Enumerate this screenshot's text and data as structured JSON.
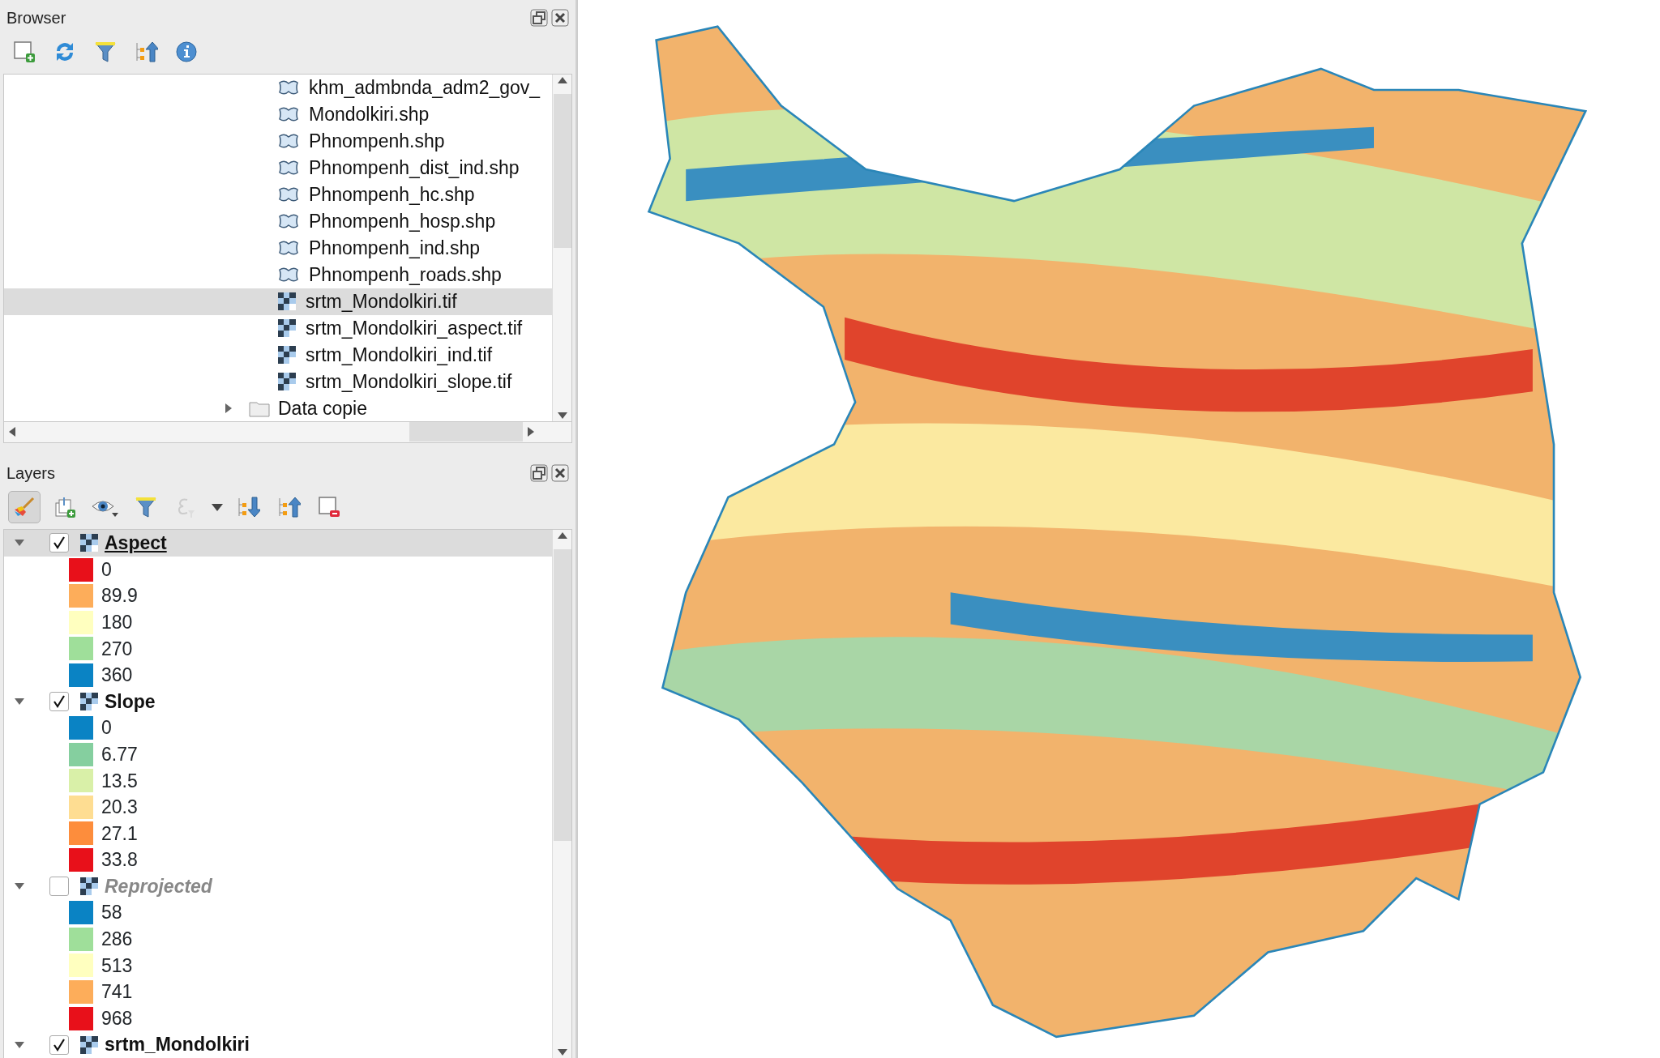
{
  "browser": {
    "title": "Browser",
    "items": [
      {
        "label": "khm_admbnda_adm2_gov_",
        "kind": "vector",
        "selected": false
      },
      {
        "label": "Mondolkiri.shp",
        "kind": "vector",
        "selected": false
      },
      {
        "label": "Phnompenh.shp",
        "kind": "vector",
        "selected": false
      },
      {
        "label": "Phnompenh_dist_ind.shp",
        "kind": "vector",
        "selected": false
      },
      {
        "label": "Phnompenh_hc.shp",
        "kind": "vector",
        "selected": false
      },
      {
        "label": "Phnompenh_hosp.shp",
        "kind": "vector",
        "selected": false
      },
      {
        "label": "Phnompenh_ind.shp",
        "kind": "vector",
        "selected": false
      },
      {
        "label": "Phnompenh_roads.shp",
        "kind": "vector",
        "selected": false
      },
      {
        "label": "srtm_Mondolkiri.tif",
        "kind": "raster",
        "selected": true
      },
      {
        "label": "srtm_Mondolkiri_aspect.tif",
        "kind": "raster",
        "selected": false
      },
      {
        "label": "srtm_Mondolkiri_ind.tif",
        "kind": "raster",
        "selected": false
      },
      {
        "label": "srtm_Mondolkiri_slope.tif",
        "kind": "raster",
        "selected": false
      },
      {
        "label": "Data copie",
        "kind": "folder",
        "selected": false,
        "expanded": false
      }
    ]
  },
  "layers": {
    "title": "Layers",
    "items": [
      {
        "name": "Aspect",
        "checked": true,
        "expanded": true,
        "selected": true,
        "children": [
          {
            "label": "0",
            "color": "#e8101a"
          },
          {
            "label": "89.9",
            "color": "#fdad5a"
          },
          {
            "label": "180",
            "color": "#ffffbf"
          },
          {
            "label": "270",
            "color": "#9fdf9a"
          },
          {
            "label": "360",
            "color": "#0a83c4"
          }
        ]
      },
      {
        "name": "Slope",
        "checked": true,
        "expanded": true,
        "selected": false,
        "children": [
          {
            "label": "0",
            "color": "#0a83c4"
          },
          {
            "label": "6.77",
            "color": "#85cf9f"
          },
          {
            "label": "13.5",
            "color": "#d9f0a8"
          },
          {
            "label": "20.3",
            "color": "#fedd92"
          },
          {
            "label": "27.1",
            "color": "#fd8d3c"
          },
          {
            "label": "33.8",
            "color": "#e8101a"
          }
        ]
      },
      {
        "name": "Reprojected",
        "checked": false,
        "expanded": true,
        "selected": false,
        "children": [
          {
            "label": "58",
            "color": "#0a83c4"
          },
          {
            "label": "286",
            "color": "#9fdf9a"
          },
          {
            "label": "513",
            "color": "#ffffbf"
          },
          {
            "label": "741",
            "color": "#fdad5a"
          },
          {
            "label": "968",
            "color": "#e8101a"
          }
        ]
      },
      {
        "name": "srtm_Mondolkiri",
        "checked": true,
        "expanded": true,
        "selected": false
      }
    ]
  }
}
